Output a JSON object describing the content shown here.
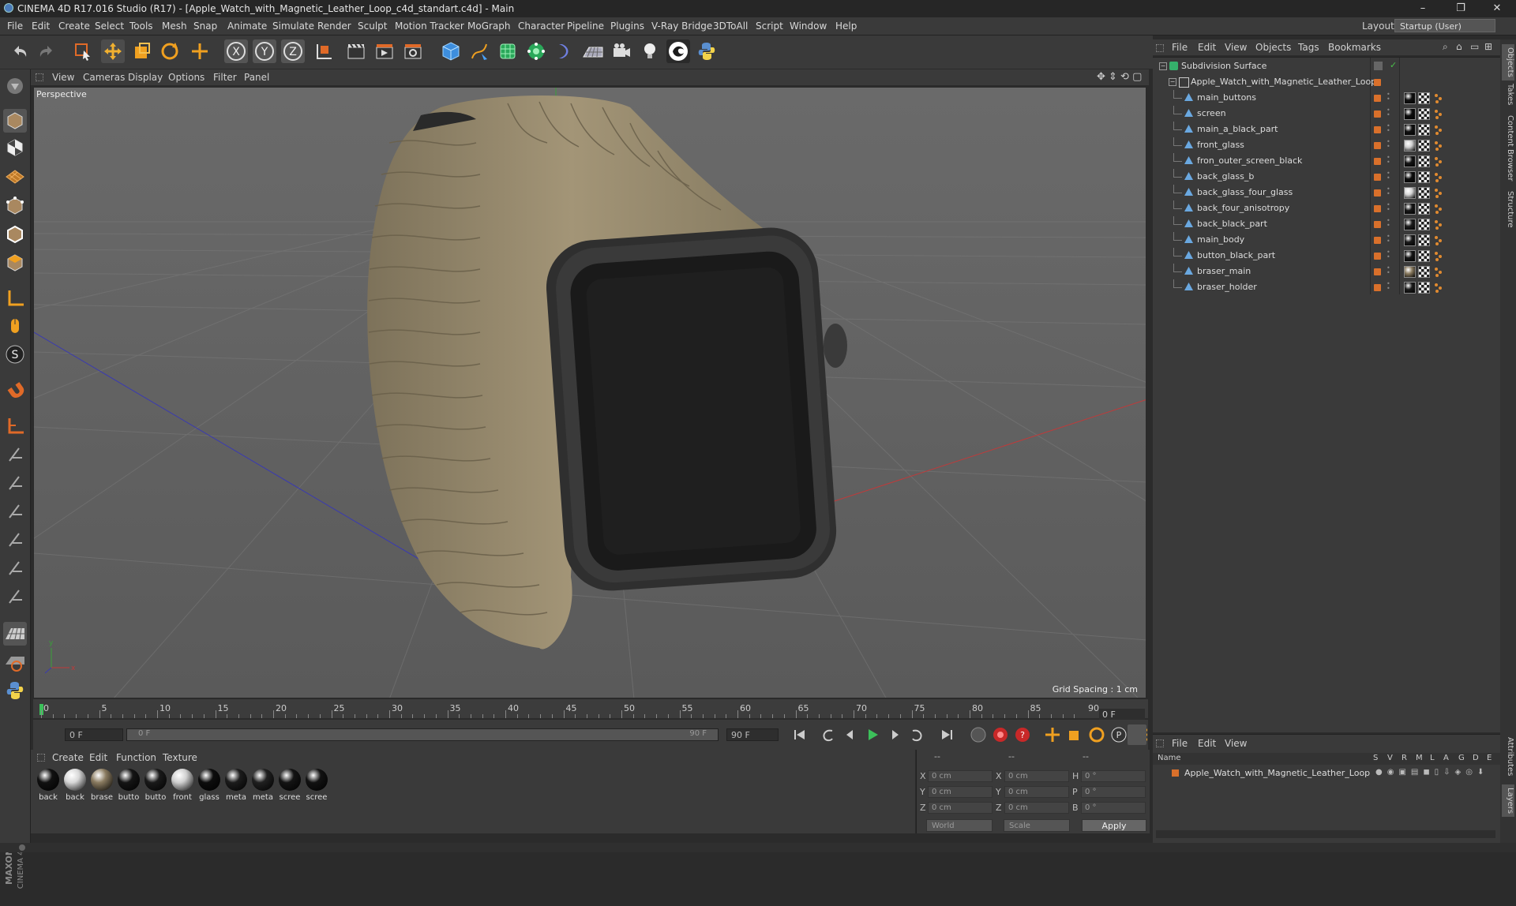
{
  "window": {
    "title": "CINEMA 4D R17.016 Studio (R17) - [Apple_Watch_with_Magnetic_Leather_Loop_c4d_standart.c4d] - Main",
    "controls": [
      "–",
      "❐",
      "✕"
    ]
  },
  "menubar": {
    "items": [
      "File",
      "Edit",
      "Create",
      "Select",
      "Tools",
      "Mesh",
      "Snap",
      "Animate",
      "Simulate",
      "Render",
      "Sculpt",
      "Motion Tracker",
      "MoGraph",
      "Character",
      "Pipeline",
      "Plugins",
      "V-Ray Bridge",
      "3DToAll",
      "Script",
      "Window",
      "Help"
    ],
    "layout_label": "Layout:",
    "layout_value": "Startup (User)"
  },
  "viewport": {
    "menu": [
      "View",
      "Cameras",
      "Display",
      "Options",
      "Filter",
      "Panel"
    ],
    "label": "Perspective",
    "grid_spacing": "Grid Spacing : 1 cm"
  },
  "timeline": {
    "ticks": [
      "0",
      "5",
      "10",
      "15",
      "20",
      "25",
      "30",
      "35",
      "40",
      "45",
      "50",
      "55",
      "60",
      "65",
      "70",
      "75",
      "80",
      "85",
      "90"
    ],
    "current_frame": "0 F",
    "start_field": "0 F",
    "range_start": "0 F",
    "range_end": "90 F",
    "end_field": "90 F"
  },
  "material_manager": {
    "menu": [
      "Create",
      "Edit",
      "Function",
      "Texture"
    ],
    "materials": [
      {
        "name": "back",
        "color": "#111111"
      },
      {
        "name": "back",
        "color": "#d8d8d8"
      },
      {
        "name": "brase",
        "color": "#8a7b60"
      },
      {
        "name": "butto",
        "color": "#151515"
      },
      {
        "name": "butto",
        "color": "#1a1a1a"
      },
      {
        "name": "front",
        "color": "#d0d0d0"
      },
      {
        "name": "glass",
        "color": "#0d0d0d"
      },
      {
        "name": "meta",
        "color": "#1c1c1c"
      },
      {
        "name": "meta",
        "color": "#202020"
      },
      {
        "name": "scree",
        "color": "#141414"
      },
      {
        "name": "scree",
        "color": "#121212"
      }
    ]
  },
  "coordinates": {
    "header": [
      "--",
      "--",
      "--"
    ],
    "rows": [
      {
        "axis": "X",
        "pos": "0 cm",
        "axis2": "X",
        "size": "0 cm",
        "rot_label": "H",
        "rot": "0 °"
      },
      {
        "axis": "Y",
        "pos": "0 cm",
        "axis2": "Y",
        "size": "0 cm",
        "rot_label": "P",
        "rot": "0 °"
      },
      {
        "axis": "Z",
        "pos": "0 cm",
        "axis2": "Z",
        "size": "0 cm",
        "rot_label": "B",
        "rot": "0 °"
      }
    ],
    "space": "World",
    "mode": "Scale",
    "apply": "Apply"
  },
  "object_manager": {
    "menu": [
      "File",
      "Edit",
      "View",
      "Objects",
      "Tags",
      "Bookmarks"
    ],
    "root": "Subdivision Surface",
    "group": "Apple_Watch_with_Magnetic_Leather_Loop",
    "children": [
      "main_buttons",
      "screen",
      "main_a_black_part",
      "front_glass",
      "fron_outer_screen_black",
      "back_glass_b",
      "back_glass_four_glass",
      "back_four_anisotropy",
      "back_black_part",
      "main_body",
      "button_black_part",
      "braser_main",
      "braser_holder"
    ],
    "child_tag_colors": [
      "#111111",
      "#0d0d0d",
      "#111111",
      "#cfcfcf",
      "#141414",
      "#0e0e0e",
      "#d5d5d5",
      "#171717",
      "#1c1c1c",
      "#1a1a1a",
      "#151515",
      "#8a7b60",
      "#1b1b1b"
    ]
  },
  "layer_manager": {
    "menu": [
      "File",
      "Edit",
      "View"
    ],
    "columns": [
      "Name",
      "S",
      "V",
      "R",
      "M",
      "L",
      "A",
      "G",
      "D",
      "E"
    ],
    "row": "Apple_Watch_with_Magnetic_Leather_Loop"
  },
  "right_tabs": [
    "Objects",
    "Takes",
    "Content Browser",
    "Structure",
    "Attributes",
    "Layers"
  ],
  "branding": {
    "logo": "MAXON CINEMA 4D"
  },
  "colors": {
    "accent_orange": "#d9702b",
    "panel": "#3a3a3a",
    "viewport": "#5f5f5f",
    "leather": "#9a8c6e",
    "watch_body": "#2e2e2e"
  }
}
